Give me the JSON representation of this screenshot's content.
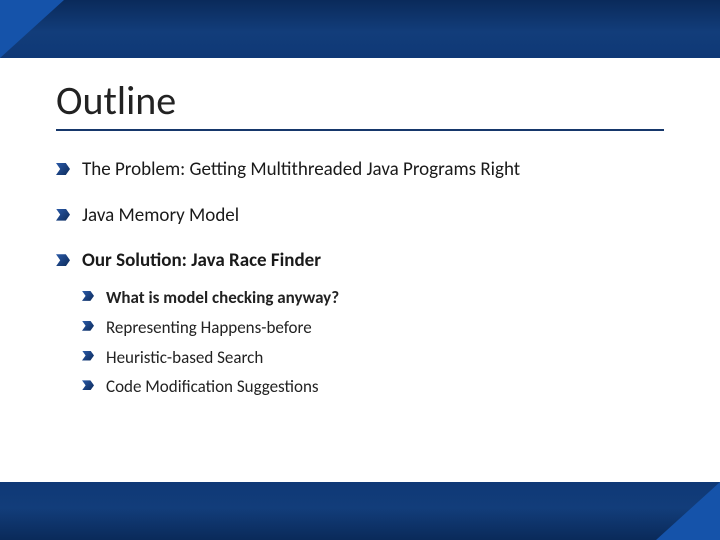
{
  "title": "Outline",
  "items": [
    {
      "text": "The Problem: Getting Multithreaded Java Programs Right",
      "bold": false
    },
    {
      "text": "Java Memory Model",
      "bold": false
    },
    {
      "text": "Our Solution: Java Race Finder",
      "bold": true,
      "children": [
        {
          "text": "What is model checking anyway?",
          "bold": true
        },
        {
          "text": "Representing Happens-before",
          "bold": false
        },
        {
          "text": "Heuristic-based Search",
          "bold": false
        },
        {
          "text": "Code Modification Suggestions",
          "bold": false
        }
      ]
    }
  ]
}
